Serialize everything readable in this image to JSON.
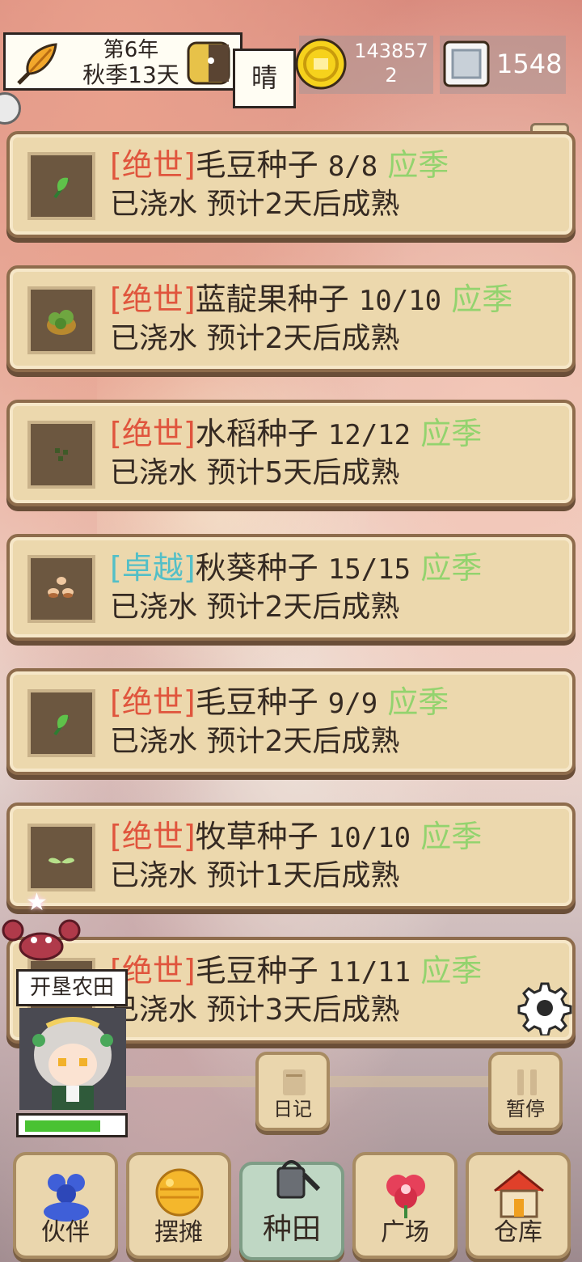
{
  "header": {
    "year_label": "第6年",
    "season_day_label": "秋季13天",
    "weather": "晴",
    "gold_amount_line1": "143857",
    "gold_amount_line2": "2",
    "silver_amount": "1548",
    "help_label": "?"
  },
  "plots": [
    {
      "rarity": "[绝世]",
      "rarity_color": "#e0553d",
      "name": "毛豆种子",
      "count": "8/8",
      "season": "应季",
      "status": "已浇水 预计2天后成熟",
      "icon": "edamame-sprout-icon"
    },
    {
      "rarity": "[绝世]",
      "rarity_color": "#e0553d",
      "name": "蓝靛果种子",
      "count": "10/10",
      "season": "应季",
      "status": "已浇水 预计2天后成熟",
      "icon": "blueberry-bush-icon"
    },
    {
      "rarity": "[绝世]",
      "rarity_color": "#e0553d",
      "name": "水稻种子",
      "count": "12/12",
      "season": "应季",
      "status": "已浇水 预计5天后成熟",
      "icon": "rice-seeds-icon"
    },
    {
      "rarity": "[卓越]",
      "rarity_color": "#53bfc7",
      "name": "秋葵种子",
      "count": "15/15",
      "season": "应季",
      "status": "已浇水 预计2天后成熟",
      "icon": "okra-seeds-icon"
    },
    {
      "rarity": "[绝世]",
      "rarity_color": "#e0553d",
      "name": "毛豆种子",
      "count": "9/9",
      "season": "应季",
      "status": "已浇水 预计2天后成熟",
      "icon": "edamame-sprout-icon"
    },
    {
      "rarity": "[绝世]",
      "rarity_color": "#e0553d",
      "name": "牧草种子",
      "count": "10/10",
      "season": "应季",
      "status": "已浇水 预计1天后成熟",
      "icon": "grass-sprout-icon"
    },
    {
      "rarity": "[绝世]",
      "rarity_color": "#e0553d",
      "name": "毛豆种子",
      "count": "11/11",
      "season": "应季",
      "status": "已浇水 预计3天后成熟",
      "icon": "edamame-sprout-icon"
    }
  ],
  "character": {
    "task_label": "开垦农田",
    "progress": 0.8
  },
  "controls": {
    "diary_label": "日记",
    "pause_label": "暂停"
  },
  "nav": [
    {
      "label": "伙伴",
      "icon": "partners-icon"
    },
    {
      "label": "摆摊",
      "icon": "stall-icon"
    },
    {
      "label": "种田",
      "icon": "watering-can-icon",
      "active": true
    },
    {
      "label": "广场",
      "icon": "flower-plaza-icon"
    },
    {
      "label": "仓库",
      "icon": "warehouse-icon"
    }
  ]
}
